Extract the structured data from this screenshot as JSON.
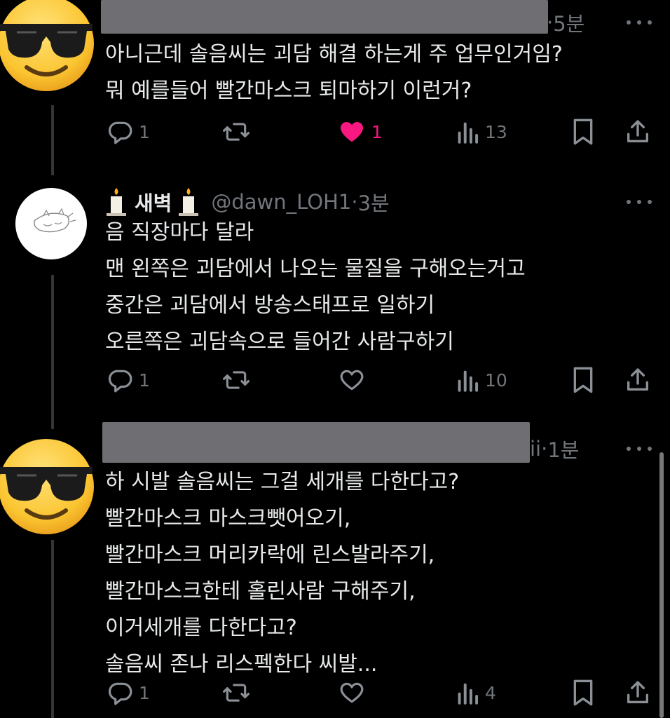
{
  "tweets": [
    {
      "author_suffix": "",
      "time": "5분",
      "lines": [
        "아니근데 솔음씨는 괴담 해결 하는게 주 업무인거임?",
        "뭐 예를들어 빨간마스크 퇴마하기 이런거?"
      ],
      "reply_count": "1",
      "like_count": "1",
      "view_count": "13"
    },
    {
      "display_name": "새벽",
      "handle": "@dawn_LOH1",
      "separator": "·",
      "time": "3분",
      "lines": [
        "음 직장마다 달라",
        "맨 왼쪽은 괴담에서 나오는 물질을 구해오는거고",
        "중간은 괴담에서 방송스태프로 일하기",
        "오른쪽은 괴담속으로 들어간 사람구하기"
      ],
      "reply_count": "1",
      "view_count": "10"
    },
    {
      "author_suffix": "ii",
      "separator": "·",
      "time": "1분",
      "lines": [
        "하 시발 솔음씨는 그걸 세개를 다한다고?",
        "빨간마스크 마스크뺏어오기,",
        "빨간마스크 머리카락에 린스발라주기,",
        "빨간마스크한테 홀린사람 구해주기,",
        "이거세개를 다한다고?",
        "솔음씨 존나 리스펙한다 씨발..."
      ],
      "reply_count": "1",
      "view_count": "4"
    }
  ],
  "colors": {
    "background": "#000000",
    "text": "#e7e9ea",
    "muted": "#71767b",
    "like": "#f91880",
    "thread": "#333639"
  },
  "icons": [
    "sunglasses-emoji-avatar",
    "reply-icon",
    "retweet-icon",
    "like-icon",
    "views-icon",
    "bookmark-icon",
    "share-icon",
    "candle-icon",
    "more-icon"
  ]
}
